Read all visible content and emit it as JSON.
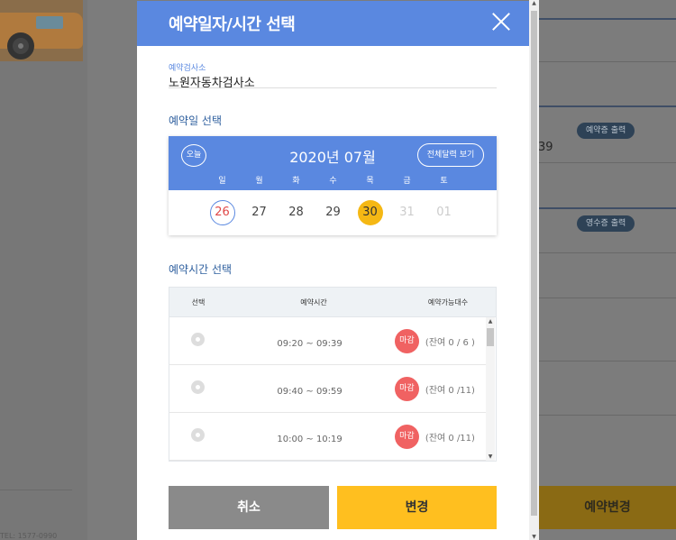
{
  "modal": {
    "title": "예약일자/시간 선택",
    "inspection_label": "예약검사소",
    "inspection_value": "노원자동차검사소",
    "date_section_title": "예약일 선택",
    "time_section_title": "예약시간 선택"
  },
  "calendar": {
    "today_label": "오늘",
    "month_title": "2020년 07월",
    "full_calendar_label": "전체달력 보기",
    "weekdays": [
      "일",
      "월",
      "화",
      "수",
      "목",
      "금",
      "토"
    ],
    "days": [
      "26",
      "27",
      "28",
      "29",
      "30",
      "31",
      "01"
    ],
    "selected_day": "30"
  },
  "time_table": {
    "headers": [
      "선택",
      "예약시간",
      "예약가능대수"
    ],
    "rows": [
      {
        "time": "09:20 ~ 09:39",
        "status": "마감",
        "remaining": "(잔여  0 / 6 )"
      },
      {
        "time": "09:40 ~ 09:59",
        "status": "마감",
        "remaining": "(잔여  0 /11)"
      },
      {
        "time": "10:00 ~ 10:19",
        "status": "마감",
        "remaining": "(잔여  0 /11)"
      }
    ]
  },
  "buttons": {
    "cancel": "취소",
    "change": "변경"
  },
  "background": {
    "number_fragment": "39",
    "pill_1": "예약증 출력",
    "pill_2": "영수증 출력",
    "reserve_change": "예약변경",
    "footer_fragment": "TEL: 1577-0990"
  },
  "colors": {
    "header_blue": "#5a88e0",
    "accent_yellow": "#ffbf1f",
    "closed_red": "#f06262",
    "cancel_gray": "#8a8a8a"
  }
}
